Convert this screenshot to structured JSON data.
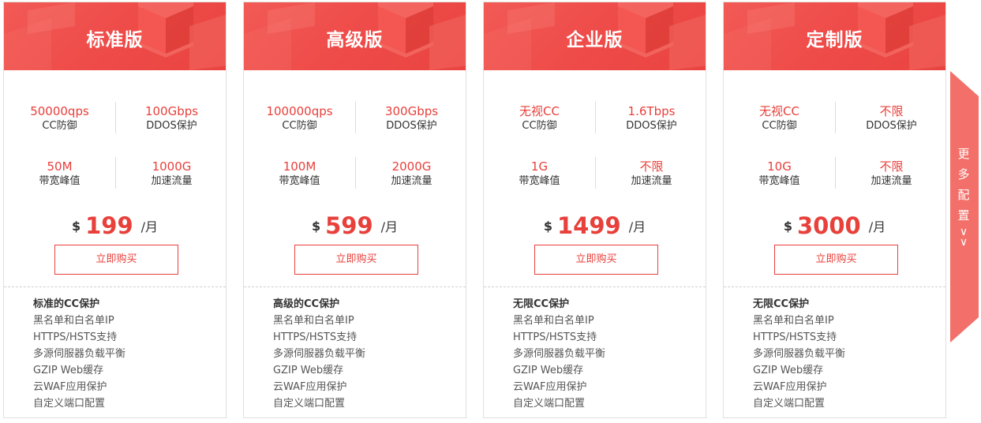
{
  "plans": [
    {
      "name": "标准版",
      "stats": [
        {
          "value": "50000qps",
          "label": "CC防御"
        },
        {
          "value": "100Gbps",
          "label": "DDOS保护"
        },
        {
          "value": "50M",
          "label": "带宽峰值"
        },
        {
          "value": "1000G",
          "label": "加速流量"
        }
      ],
      "currency": "$",
      "price": "199",
      "unit": "/月",
      "buy_label": "立即购买",
      "features_title": "标准的CC保护",
      "features": [
        "黑名单和白名单IP",
        "HTTPS/HSTS支持",
        "多源伺服器负载平衡",
        "GZIP Web缓存",
        "云WAF应用保护",
        "自定义端口配置"
      ]
    },
    {
      "name": "高级版",
      "stats": [
        {
          "value": "100000qps",
          "label": "CC防御"
        },
        {
          "value": "300Gbps",
          "label": "DDOS保护"
        },
        {
          "value": "100M",
          "label": "带宽峰值"
        },
        {
          "value": "2000G",
          "label": "加速流量"
        }
      ],
      "currency": "$",
      "price": "599",
      "unit": "/月",
      "buy_label": "立即购买",
      "features_title": "高级的CC保护",
      "features": [
        "黑名单和白名单IP",
        "HTTPS/HSTS支持",
        "多源伺服器负载平衡",
        "GZIP Web缓存",
        "云WAF应用保护",
        "自定义端口配置"
      ]
    },
    {
      "name": "企业版",
      "stats": [
        {
          "value": "无视CC",
          "label": "CC防御"
        },
        {
          "value": "1.6Tbps",
          "label": "DDOS保护"
        },
        {
          "value": "1G",
          "label": "带宽峰值"
        },
        {
          "value": "不限",
          "label": "加速流量"
        }
      ],
      "currency": "$",
      "price": "1499",
      "unit": "/月",
      "buy_label": "立即购买",
      "features_title": "无限CC保护",
      "features": [
        "黑名单和白名单IP",
        "HTTPS/HSTS支持",
        "多源伺服器负载平衡",
        "GZIP Web缓存",
        "云WAF应用保护",
        "自定义端口配置"
      ]
    },
    {
      "name": "定制版",
      "stats": [
        {
          "value": "无视CC",
          "label": "CC防御"
        },
        {
          "value": "不限",
          "label": "DDOS保护"
        },
        {
          "value": "10G",
          "label": "带宽峰值"
        },
        {
          "value": "不限",
          "label": "加速流量"
        }
      ],
      "currency": "$",
      "price": "3000",
      "unit": "/月",
      "buy_label": "立即购买",
      "features_title": "无限CC保护",
      "features": [
        "黑名单和白名单IP",
        "HTTPS/HSTS支持",
        "多源伺服器负载平衡",
        "GZIP Web缓存",
        "云WAF应用保护",
        "自定义端口配置"
      ]
    }
  ],
  "more_tab": {
    "label": "更多配置",
    "icon": "double-chevron-down-icon"
  },
  "colors": {
    "accent": "#e8403b",
    "header": "#ee4a48",
    "tab": "#f36f69"
  }
}
